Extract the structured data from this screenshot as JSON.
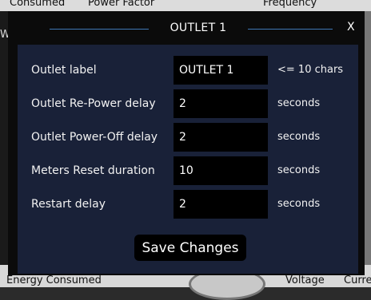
{
  "background": {
    "top_labels": [
      "Consumed",
      "Power Factor",
      "Frequency"
    ],
    "left_partial": "W",
    "bottom_labels": [
      "Energy Consumed",
      "Voltage",
      "Curre"
    ]
  },
  "modal": {
    "title": "OUTLET 1",
    "close_label": "X",
    "rows": [
      {
        "label": "Outlet label",
        "value": "OUTLET 1",
        "hint": "<= 10 chars"
      },
      {
        "label": "Outlet Re-Power delay",
        "value": "2",
        "hint": "seconds"
      },
      {
        "label": "Outlet Power-Off delay",
        "value": "2",
        "hint": "seconds"
      },
      {
        "label": "Meters Reset duration",
        "value": "10",
        "hint": "seconds"
      },
      {
        "label": "Restart delay",
        "value": "2",
        "hint": "seconds"
      }
    ],
    "save_label": "Save Changes"
  },
  "colors": {
    "modal_frame": "#0b0b0b",
    "modal_body": "#192138",
    "accent_line": "#3f78b5",
    "field_bg": "#000000"
  }
}
